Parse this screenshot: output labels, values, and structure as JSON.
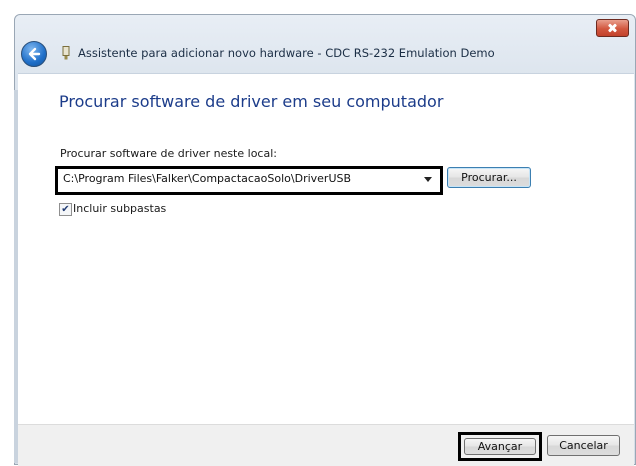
{
  "window": {
    "title": "Assistente para adicionar novo hardware - CDC RS-232 Emulation Demo"
  },
  "page": {
    "heading": "Procurar software de driver em seu computador",
    "field_label": "Procurar software de driver neste local:",
    "path_value": "C:\\Program Files\\Falker\\CompactacaoSolo\\DriverUSB",
    "browse_label": "Procurar...",
    "checkbox_label": "Incluir subpastas",
    "checkbox_checked": true
  },
  "footer": {
    "next_label": "Avançar",
    "cancel_label": "Cancelar"
  },
  "icons": {
    "close": "close-icon",
    "back": "back-arrow-icon",
    "device": "usb-device-icon",
    "dropdown": "chevron-down-icon",
    "check": "checkmark-icon"
  }
}
